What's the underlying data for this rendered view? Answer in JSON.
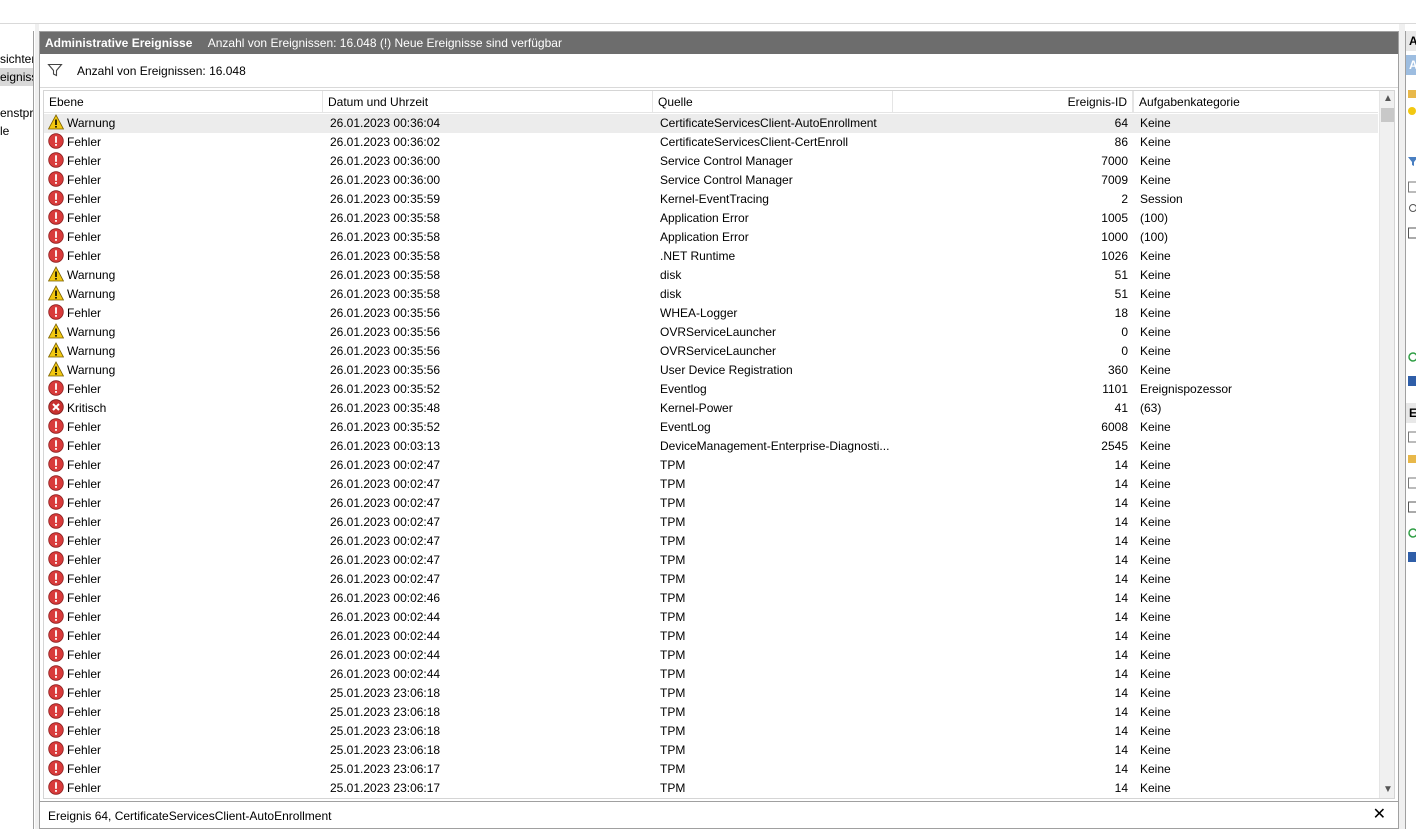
{
  "left_tree": {
    "items": [
      {
        "label": "sichter",
        "selected": false
      },
      {
        "label": "eignisse",
        "selected": true
      },
      {
        "label": "enstpro",
        "selected": false
      },
      {
        "label": "le",
        "selected": false
      }
    ]
  },
  "main": {
    "title": "Administrative Ereignisse",
    "title_info": "Anzahl von Ereignissen: 16.048 (!) Neue Ereignisse sind verfügbar",
    "filter_text": "Anzahl von Ereignissen: 16.048",
    "columns": [
      "Ebene",
      "Datum und Uhrzeit",
      "Quelle",
      "",
      "Ereignis-ID",
      "Aufgabenkategorie"
    ],
    "rows": [
      {
        "level": "Warnung",
        "type": "warning",
        "date": "26.01.2023 00:36:04",
        "source": "CertificateServicesClient-AutoEnrollment",
        "id": "64",
        "category": "Keine"
      },
      {
        "level": "Fehler",
        "type": "error",
        "date": "26.01.2023 00:36:02",
        "source": "CertificateServicesClient-CertEnroll",
        "id": "86",
        "category": "Keine"
      },
      {
        "level": "Fehler",
        "type": "error",
        "date": "26.01.2023 00:36:00",
        "source": "Service Control Manager",
        "id": "7000",
        "category": "Keine"
      },
      {
        "level": "Fehler",
        "type": "error",
        "date": "26.01.2023 00:36:00",
        "source": "Service Control Manager",
        "id": "7009",
        "category": "Keine"
      },
      {
        "level": "Fehler",
        "type": "error",
        "date": "26.01.2023 00:35:59",
        "source": "Kernel-EventTracing",
        "id": "2",
        "category": "Session"
      },
      {
        "level": "Fehler",
        "type": "error",
        "date": "26.01.2023 00:35:58",
        "source": "Application Error",
        "id": "1005",
        "category": "(100)"
      },
      {
        "level": "Fehler",
        "type": "error",
        "date": "26.01.2023 00:35:58",
        "source": "Application Error",
        "id": "1000",
        "category": "(100)"
      },
      {
        "level": "Fehler",
        "type": "error",
        "date": "26.01.2023 00:35:58",
        "source": ".NET Runtime",
        "id": "1026",
        "category": "Keine"
      },
      {
        "level": "Warnung",
        "type": "warning",
        "date": "26.01.2023 00:35:58",
        "source": "disk",
        "id": "51",
        "category": "Keine"
      },
      {
        "level": "Warnung",
        "type": "warning",
        "date": "26.01.2023 00:35:58",
        "source": "disk",
        "id": "51",
        "category": "Keine"
      },
      {
        "level": "Fehler",
        "type": "error",
        "date": "26.01.2023 00:35:56",
        "source": "WHEA-Logger",
        "id": "18",
        "category": "Keine"
      },
      {
        "level": "Warnung",
        "type": "warning",
        "date": "26.01.2023 00:35:56",
        "source": "OVRServiceLauncher",
        "id": "0",
        "category": "Keine"
      },
      {
        "level": "Warnung",
        "type": "warning",
        "date": "26.01.2023 00:35:56",
        "source": "OVRServiceLauncher",
        "id": "0",
        "category": "Keine"
      },
      {
        "level": "Warnung",
        "type": "warning",
        "date": "26.01.2023 00:35:56",
        "source": "User Device Registration",
        "id": "360",
        "category": "Keine"
      },
      {
        "level": "Fehler",
        "type": "error",
        "date": "26.01.2023 00:35:52",
        "source": "Eventlog",
        "id": "1101",
        "category": "Ereignispozessor"
      },
      {
        "level": "Kritisch",
        "type": "critical",
        "date": "26.01.2023 00:35:48",
        "source": "Kernel-Power",
        "id": "41",
        "category": "(63)"
      },
      {
        "level": "Fehler",
        "type": "error",
        "date": "26.01.2023 00:35:52",
        "source": "EventLog",
        "id": "6008",
        "category": "Keine"
      },
      {
        "level": "Fehler",
        "type": "error",
        "date": "26.01.2023 00:03:13",
        "source": "DeviceManagement-Enterprise-Diagnosti...",
        "id": "2545",
        "category": "Keine"
      },
      {
        "level": "Fehler",
        "type": "error",
        "date": "26.01.2023 00:02:47",
        "source": "TPM",
        "id": "14",
        "category": "Keine"
      },
      {
        "level": "Fehler",
        "type": "error",
        "date": "26.01.2023 00:02:47",
        "source": "TPM",
        "id": "14",
        "category": "Keine"
      },
      {
        "level": "Fehler",
        "type": "error",
        "date": "26.01.2023 00:02:47",
        "source": "TPM",
        "id": "14",
        "category": "Keine"
      },
      {
        "level": "Fehler",
        "type": "error",
        "date": "26.01.2023 00:02:47",
        "source": "TPM",
        "id": "14",
        "category": "Keine"
      },
      {
        "level": "Fehler",
        "type": "error",
        "date": "26.01.2023 00:02:47",
        "source": "TPM",
        "id": "14",
        "category": "Keine"
      },
      {
        "level": "Fehler",
        "type": "error",
        "date": "26.01.2023 00:02:47",
        "source": "TPM",
        "id": "14",
        "category": "Keine"
      },
      {
        "level": "Fehler",
        "type": "error",
        "date": "26.01.2023 00:02:47",
        "source": "TPM",
        "id": "14",
        "category": "Keine"
      },
      {
        "level": "Fehler",
        "type": "error",
        "date": "26.01.2023 00:02:46",
        "source": "TPM",
        "id": "14",
        "category": "Keine"
      },
      {
        "level": "Fehler",
        "type": "error",
        "date": "26.01.2023 00:02:44",
        "source": "TPM",
        "id": "14",
        "category": "Keine"
      },
      {
        "level": "Fehler",
        "type": "error",
        "date": "26.01.2023 00:02:44",
        "source": "TPM",
        "id": "14",
        "category": "Keine"
      },
      {
        "level": "Fehler",
        "type": "error",
        "date": "26.01.2023 00:02:44",
        "source": "TPM",
        "id": "14",
        "category": "Keine"
      },
      {
        "level": "Fehler",
        "type": "error",
        "date": "26.01.2023 00:02:44",
        "source": "TPM",
        "id": "14",
        "category": "Keine"
      },
      {
        "level": "Fehler",
        "type": "error",
        "date": "25.01.2023 23:06:18",
        "source": "TPM",
        "id": "14",
        "category": "Keine"
      },
      {
        "level": "Fehler",
        "type": "error",
        "date": "25.01.2023 23:06:18",
        "source": "TPM",
        "id": "14",
        "category": "Keine"
      },
      {
        "level": "Fehler",
        "type": "error",
        "date": "25.01.2023 23:06:18",
        "source": "TPM",
        "id": "14",
        "category": "Keine"
      },
      {
        "level": "Fehler",
        "type": "error",
        "date": "25.01.2023 23:06:18",
        "source": "TPM",
        "id": "14",
        "category": "Keine"
      },
      {
        "level": "Fehler",
        "type": "error",
        "date": "25.01.2023 23:06:17",
        "source": "TPM",
        "id": "14",
        "category": "Keine"
      },
      {
        "level": "Fehler",
        "type": "error",
        "date": "25.01.2023 23:06:17",
        "source": "TPM",
        "id": "14",
        "category": "Keine"
      }
    ]
  },
  "detail": {
    "title": "Ereignis 64, CertificateServicesClient-AutoEnrollment",
    "close_symbol": "✕"
  },
  "right_pane": {
    "header_top": "A",
    "header_selected": "A",
    "header_bottom": "E"
  },
  "colors": {
    "title_bar": "#6d6d6d",
    "error": "#d83b3b",
    "warning": "#f2c811",
    "critical": "#c8312f",
    "selected_row": "#ececec"
  }
}
